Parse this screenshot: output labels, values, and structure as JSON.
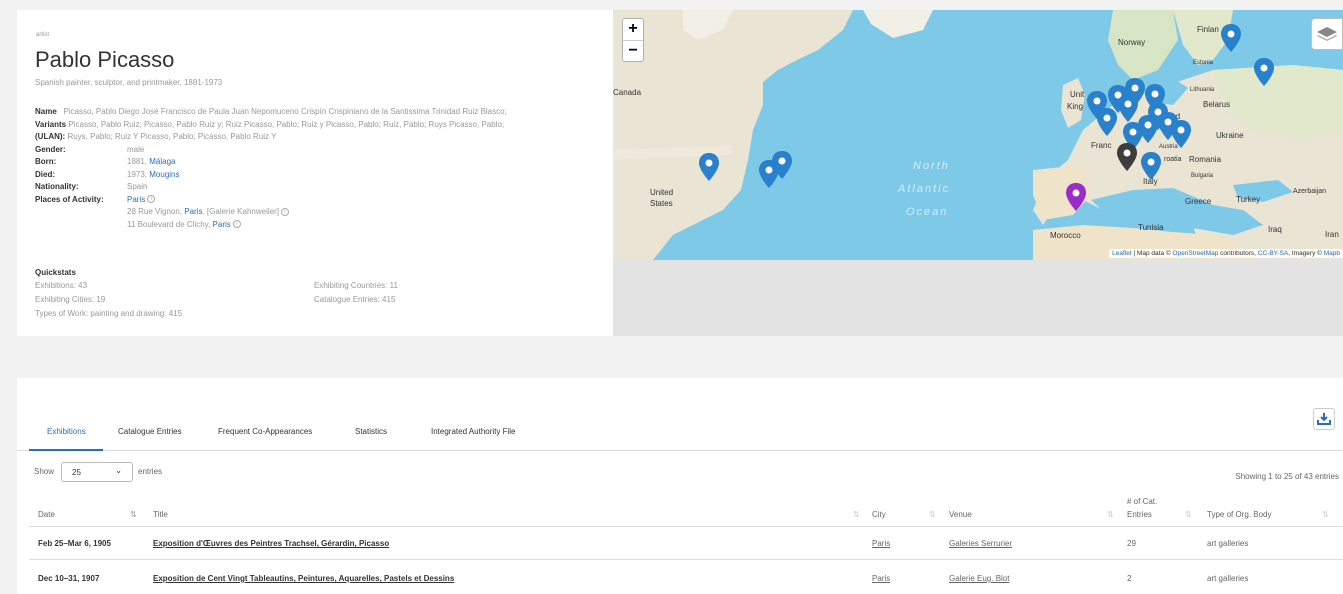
{
  "profile": {
    "kind": "artist",
    "name": "Pablo Picasso",
    "description": "Spanish painter, sculptor, and printmaker, 1881-1973",
    "name_label": "Name",
    "name_value": "Picasso, Pablo Diego José Francisco de Paula Juan Nepomuceno Crispín Crispiniano de la Santissima Trinidad Ruiz Blasco;",
    "variants_label": "Variants",
    "variants_value_1": "Picasso, Pablo Ruiz; Picasso, Pablo Ruiz y; Ruiz Picasso, Pablo; Ruiz y Picasso, Pablo; Ruiz, Pablo; Ruys Picasso, Pablo;",
    "ulan_label": "(ULAN):",
    "variants_value_2": "Ruys, Pablo; Ruiz Y Picasso, Pablo; Picasso, Pablo Ruiz Y",
    "gender_label": "Gender:",
    "gender_value": "male",
    "born_label": "Born:",
    "born_year": "1881,",
    "born_place": "Málaga",
    "died_label": "Died:",
    "died_year": "1973,",
    "died_place": "Mougins",
    "nationality_label": "Nationality:",
    "nationality_value": "Spain",
    "places_label": "Places of Activity:",
    "place_1": "Paris",
    "place_2_prefix": "28 Rue Vignon,",
    "place_2_link": "Paris",
    "place_2_suffix": ", [Galerie Kahnweiler]",
    "place_3_prefix": "11 Boulevard de Clichy,",
    "place_3_link": "Paris",
    "info_glyph": "i"
  },
  "quickstats": {
    "title": "Quickstats",
    "exhibitions": "Exhibitions: 43",
    "countries": "Exhibiting Countries: 11",
    "cities": "Exhibiting Cities: 19",
    "entries": "Catalogue Entries: 415",
    "types": "Types of Work: painting and drawing: 415"
  },
  "map": {
    "zoom_in": "+",
    "zoom_out": "−",
    "labels": {
      "canada": "Canada",
      "us1": "United",
      "us2": "States",
      "norway": "Norway",
      "finland": "Finlan",
      "estonia": "Estonia",
      "lithuania": "Lithuania",
      "belarus": "Belarus",
      "uk1": "Unit",
      "uk2": "King",
      "poland": "land",
      "ukraine": "Ukraine",
      "france": "Franc",
      "austria": "Austria",
      "croatia": "roatia",
      "romania": "Romania",
      "bulgaria": "Bulgaria",
      "italy": "Italy",
      "greece": "Greece",
      "turkey": "Turkey",
      "azerbaijan": "Azerbaijan",
      "spain": "n",
      "tunisia": "Tunisia",
      "morocco": "Morocco",
      "iraq": "Iraq",
      "iran": "Iran"
    },
    "ocean_1": "North",
    "ocean_2": "Atlantic",
    "ocean_3": "Ocean",
    "attribution_leaflet": "Leaflet",
    "attribution_text_1": " | Map data © ",
    "attribution_osm": "OpenStreetMap",
    "attribution_text_2": " contributors, ",
    "attribution_cc": "CC-BY-SA",
    "attribution_text_3": ", Imagery © ",
    "attribution_mapbox": "Mapb",
    "colors": {
      "water": "#7ec8e8",
      "marker_blue": "#2a81cb",
      "marker_black": "#3d3d3d",
      "marker_violet": "#9c2bcb"
    }
  },
  "tabs": [
    "Exhibitions",
    "Catalogue Entries",
    "Frequent Co-Appearances",
    "Statistics",
    "Integrated Authority File"
  ],
  "table_controls": {
    "show": "Show",
    "page_size": "25",
    "entries": "entries",
    "showing": "Showing 1 to 25 of 43 entries"
  },
  "table": {
    "headers": {
      "date": "Date",
      "title": "Title",
      "city": "City",
      "venue": "Venue",
      "cat_1": "# of Cat.",
      "cat_2": "Entries",
      "org": "Type of Org. Body"
    },
    "rows": [
      {
        "date": "Feb 25–Mar 6, 1905",
        "title": "Exposition d'Œuvres des Peintres Trachsel, Gérardin, Picasso",
        "city": "Paris",
        "venue": "Galeries Serrurier",
        "entries": "29",
        "org": "art galleries"
      },
      {
        "date": "Dec 10–31, 1907",
        "title": "Exposition de Cent Vingt Tableautins, Peintures, Aquarelles, Pastels et Dessins",
        "city": "Paris",
        "venue": "Galerie Eug. Blot",
        "entries": "2",
        "org": "art galleries"
      }
    ]
  }
}
